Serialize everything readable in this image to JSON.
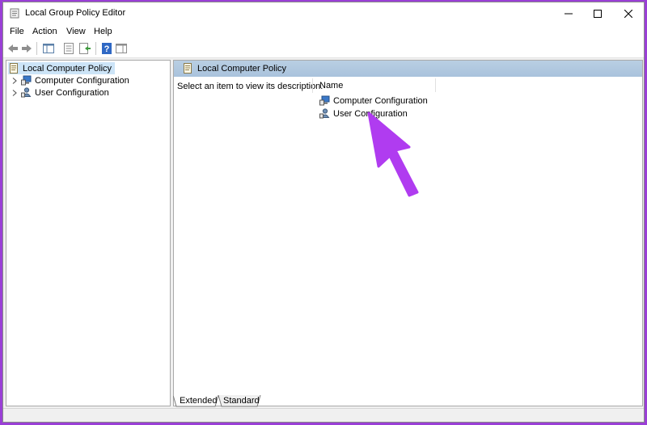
{
  "window": {
    "title": "Local Group Policy Editor"
  },
  "window_controls": {
    "minimize_icon": "minimize-icon",
    "maximize_icon": "maximize-icon",
    "close_icon": "close-icon"
  },
  "menu": {
    "items": [
      "File",
      "Action",
      "View",
      "Help"
    ]
  },
  "toolbar": {
    "buttons": [
      "back-arrow-icon",
      "forward-arrow-icon",
      "show-hide-console-tree-icon",
      "properties-icon",
      "export-list-icon",
      "help-icon",
      "show-hide-action-pane-icon"
    ]
  },
  "tree": {
    "root": "Local Computer Policy",
    "children": [
      "Computer Configuration",
      "User Configuration"
    ]
  },
  "details": {
    "header": "Local Computer Policy",
    "description": "Select an item to view its description.",
    "column_name": "Name",
    "items": [
      "Computer Configuration",
      "User Configuration"
    ]
  },
  "tabs": [
    "Extended",
    "Standard"
  ],
  "annotation": {
    "color": "#b03cf0",
    "icon": "pointer-arrow"
  },
  "colors": {
    "background": "#9a3fd6",
    "selection": "#cce4f7",
    "banner": "#b4cbe1"
  }
}
